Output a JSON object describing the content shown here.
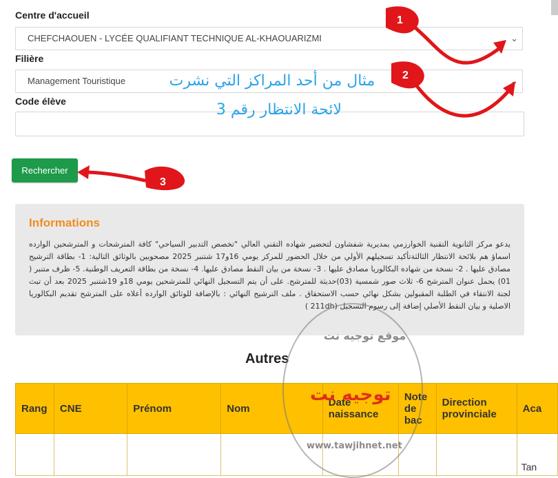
{
  "form": {
    "centre_label": "Centre d'accueil",
    "centre_value": "CHEFCHAOUEN - LYCÉE QUALIFIANT TECHNIQUE AL-KHAOUARIZMI",
    "filiere_label": "Filière",
    "filiere_value": "Management Touristique",
    "code_label": "Code élève",
    "code_value": "",
    "search_button": "Rechercher"
  },
  "overlay": {
    "line1": "مثال من أحد المراكز التي نشرت",
    "line2": "لائحة الانتظار رقم 3",
    "arrow_labels": [
      "1",
      "2",
      "3"
    ]
  },
  "info": {
    "title": "Informations",
    "text": "يدعو مركز الثانوية التقنية الخوارزمي بمديرية شفشاون لتحضير شهاده التقني العالي \"تخصص التدبير السياحي\" كافة المترشحات و المترشحين الوارده اسماؤ هم بلائحة الانتظار الثالثةتأكيد تسجيلهم الأولي من خلال الحضور للمركز يومي 16و17 شتنبر 2025 مصحوبين بالوثائق التالية: 1- بطاقة الترشيح مصادق عليها . 2- نسخة من شهاده البكالوريا مصادق عليها . 3- نسخة من بيان النقط مصادق عليها. 4- نسخة من بطاقة التعريف الوطنية. 5- ظرف متنبر ( 01) يحمل عنوان المترشح 6- ثلاث صور شمسية (03)حديثة للمترشح. على أن يتم التسجيل النهائي للمترشحين يومي 18و 19شتنبر 2025 بعد أن تبث لجنة الانتقاء في الطلبة المقبولين بشكل نهائي حسب الاستحقاق . ملف الترشيح النهائي : بالإضافة للوثائق الوارده أعلاه على المترشح تقديم البكالوريا الاصلية و بيان النقط الأصلي إضافة إلى رسوم التسجيل (211dh )"
  },
  "section_title": "Autres",
  "table": {
    "headers": [
      "Rang",
      "CNE",
      "Prénom",
      "Nom",
      "Date naissance",
      "Note de bac",
      "Direction provinciale",
      "Aca"
    ],
    "partial_cell": "Tan"
  },
  "watermark": {
    "brand": "توجيه نت",
    "arc_text": "موقع توجيه نت",
    "url": "www.tawjihnet.net"
  },
  "colors": {
    "button": "#1d9a4a",
    "info_title": "#f08c1f",
    "table_header": "#ffc000",
    "arrow": "#e0161a",
    "overlay_text": "#2aa3e8"
  }
}
